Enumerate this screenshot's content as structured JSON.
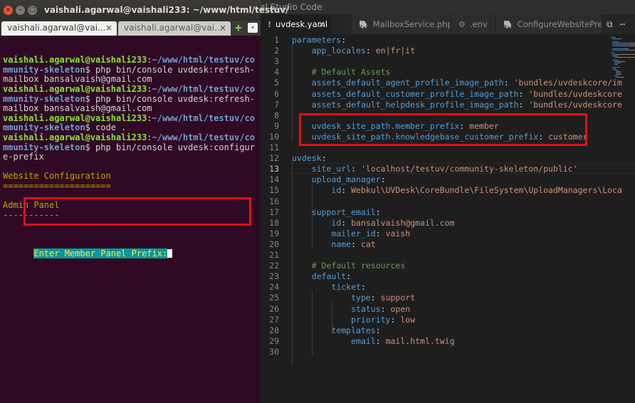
{
  "vscode": {
    "title": "Visual Studio Code",
    "tabs": [
      {
        "label": "uvdesk.yaml",
        "icon": "!",
        "active": true
      },
      {
        "label": "MailboxService.php",
        "icon": "🐘",
        "active": false
      },
      {
        "label": ".env",
        "icon": "⚙",
        "active": false
      },
      {
        "label": "ConfigureWebsitePrefixe",
        "icon": "🐘",
        "active": false
      }
    ],
    "tab_close": "×",
    "actions": {
      "split": "⧉",
      "more": "⋯"
    },
    "current_line": 13,
    "lines": [
      [
        [
          "k",
          "parameters"
        ],
        [
          "p",
          ":"
        ]
      ],
      [
        [
          "p",
          "    "
        ],
        [
          "k",
          "app_locales"
        ],
        [
          "p",
          ": "
        ],
        [
          "s",
          "en|fr|it"
        ]
      ],
      [],
      [
        [
          "p",
          "    "
        ],
        [
          "c",
          "# Default Assets"
        ]
      ],
      [
        [
          "p",
          "    "
        ],
        [
          "k",
          "assets_default_agent_profile_image_path"
        ],
        [
          "p",
          ": "
        ],
        [
          "s",
          "'bundles/uvdeskcore/im"
        ]
      ],
      [
        [
          "p",
          "    "
        ],
        [
          "k",
          "assets_default_customer_profile_image_path"
        ],
        [
          "p",
          ": "
        ],
        [
          "s",
          "'bundles/uvdeskcore"
        ]
      ],
      [
        [
          "p",
          "    "
        ],
        [
          "k",
          "assets_default_helpdesk_profile_image_path"
        ],
        [
          "p",
          ": "
        ],
        [
          "s",
          "'bundles/uvdeskcore"
        ]
      ],
      [],
      [
        [
          "p",
          "    "
        ],
        [
          "k",
          "uvdesk_site_path.member_prefix"
        ],
        [
          "p",
          ": "
        ],
        [
          "s",
          "member"
        ]
      ],
      [
        [
          "p",
          "    "
        ],
        [
          "k",
          "uvdesk_site_path.knowledgebase_customer_prefix"
        ],
        [
          "p",
          ": "
        ],
        [
          "s",
          "customer"
        ]
      ],
      [],
      [
        [
          "k",
          "uvdesk"
        ],
        [
          "p",
          ":"
        ]
      ],
      [
        [
          "p",
          "    "
        ],
        [
          "k",
          "site_url"
        ],
        [
          "p",
          ": "
        ],
        [
          "s",
          "'localhost/testuv/community-skeleton/public'"
        ]
      ],
      [
        [
          "p",
          "    "
        ],
        [
          "k",
          "upload_manager"
        ],
        [
          "p",
          ":"
        ]
      ],
      [
        [
          "p",
          "        "
        ],
        [
          "k",
          "id"
        ],
        [
          "p",
          ": "
        ],
        [
          "s",
          "Webkul\\UVDesk\\CoreBundle\\FileSystem\\UploadManagers\\Loca"
        ]
      ],
      [],
      [
        [
          "p",
          "    "
        ],
        [
          "k",
          "support_email"
        ],
        [
          "p",
          ":"
        ]
      ],
      [
        [
          "p",
          "        "
        ],
        [
          "k",
          "id"
        ],
        [
          "p",
          ": "
        ],
        [
          "s",
          "bansalvaish@gmail.com"
        ]
      ],
      [
        [
          "p",
          "        "
        ],
        [
          "k",
          "mailer_id"
        ],
        [
          "p",
          ": "
        ],
        [
          "s",
          "vaish"
        ]
      ],
      [
        [
          "p",
          "        "
        ],
        [
          "k",
          "name"
        ],
        [
          "p",
          ": "
        ],
        [
          "s",
          "cat"
        ]
      ],
      [],
      [
        [
          "p",
          "    "
        ],
        [
          "c",
          "# Default resources"
        ]
      ],
      [
        [
          "p",
          "    "
        ],
        [
          "k",
          "default"
        ],
        [
          "p",
          ":"
        ]
      ],
      [
        [
          "p",
          "        "
        ],
        [
          "k",
          "ticket"
        ],
        [
          "p",
          ":"
        ]
      ],
      [
        [
          "p",
          "            "
        ],
        [
          "k",
          "type"
        ],
        [
          "p",
          ": "
        ],
        [
          "s",
          "support"
        ]
      ],
      [
        [
          "p",
          "            "
        ],
        [
          "k",
          "status"
        ],
        [
          "p",
          ": "
        ],
        [
          "s",
          "open"
        ]
      ],
      [
        [
          "p",
          "            "
        ],
        [
          "k",
          "priority"
        ],
        [
          "p",
          ": "
        ],
        [
          "s",
          "low"
        ]
      ],
      [
        [
          "p",
          "        "
        ],
        [
          "k",
          "templates"
        ],
        [
          "p",
          ":"
        ]
      ],
      [
        [
          "p",
          "            "
        ],
        [
          "k",
          "email"
        ],
        [
          "p",
          ": "
        ],
        [
          "s",
          "mail.html.twig"
        ]
      ],
      []
    ]
  },
  "terminal": {
    "title": "vaishali.agarwal@vaishali233: ~/www/html/testuv/",
    "window_buttons": {
      "close": "×",
      "minimize": "–",
      "maximize": "□"
    },
    "tabs": [
      {
        "label": "vaishali.agarwal@vai...",
        "close": "×",
        "active": true
      },
      {
        "label": "vaishali.agarwal@vai...",
        "close": "×",
        "active": false
      }
    ],
    "new_tab_icon": "+",
    "menu_icon": "▾",
    "lines": [
      [
        [
          "u",
          "vaishali.agarwal@vaishali233"
        ],
        [
          "p",
          ":"
        ],
        [
          "w",
          "~/www/html/testuv/co"
        ]
      ],
      [
        [
          "w",
          "mmunity-skeleton"
        ],
        [
          "p",
          "$ php bin/console uvdesk:refresh-"
        ]
      ],
      [
        [
          "p",
          "mailbox bansalvaish@gmail.com"
        ]
      ],
      [
        [
          "u",
          "vaishali.agarwal@vaishali233"
        ],
        [
          "p",
          ":"
        ],
        [
          "w",
          "~/www/html/testuv/co"
        ]
      ],
      [
        [
          "w",
          "mmunity-skeleton"
        ],
        [
          "p",
          "$ php bin/console uvdesk:refresh-"
        ]
      ],
      [
        [
          "p",
          "mailbox bansalvaish@gmail.com"
        ]
      ],
      [
        [
          "u",
          "vaishali.agarwal@vaishali233"
        ],
        [
          "p",
          ":"
        ],
        [
          "w",
          "~/www/html/testuv/co"
        ]
      ],
      [
        [
          "w",
          "mmunity-skeleton"
        ],
        [
          "p",
          "$ code ."
        ]
      ],
      [
        [
          "u",
          "vaishali.agarwal@vaishali233"
        ],
        [
          "p",
          ":"
        ],
        [
          "w",
          "~/www/html/testuv/co"
        ]
      ],
      [
        [
          "w",
          "mmunity-skeleton"
        ],
        [
          "p",
          "$ php bin/console uvdesk:configur"
        ]
      ],
      [
        [
          "p",
          "e-prefix"
        ]
      ],
      [],
      [
        [
          "y",
          "Website Configuration"
        ]
      ],
      [
        [
          "y",
          "====================="
        ]
      ],
      [],
      [
        [
          "y",
          "Admin Panel"
        ]
      ],
      [
        [
          "y",
          "-----------"
        ]
      ]
    ],
    "prompt": "Enter Member Panel Prefix:"
  }
}
